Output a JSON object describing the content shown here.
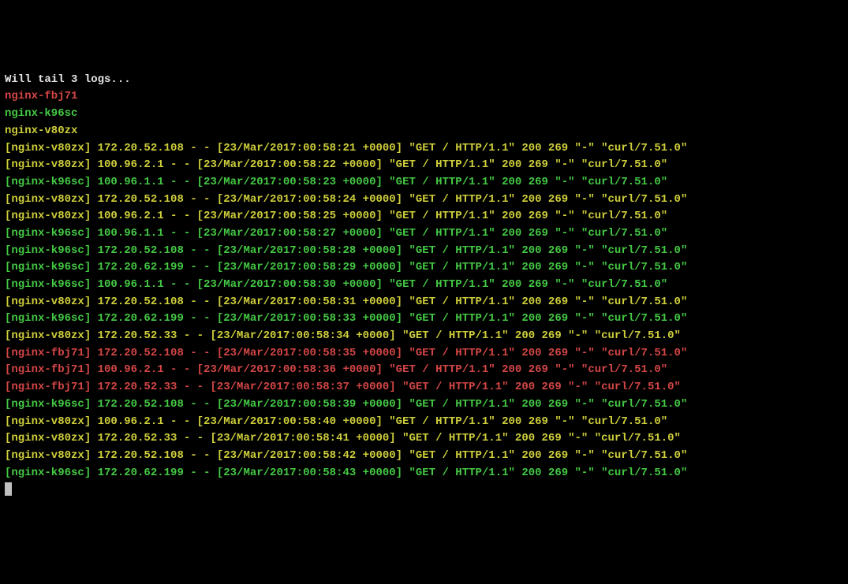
{
  "header": {
    "intro": "Will tail 3 logs...",
    "pods": [
      {
        "name": "nginx-fbj71",
        "color": "red"
      },
      {
        "name": "nginx-k96sc",
        "color": "green"
      },
      {
        "name": "nginx-v80zx",
        "color": "yellow"
      }
    ]
  },
  "logs": [
    {
      "pod": "nginx-v80zx",
      "color": "yellow",
      "msg": "172.20.52.108 - - [23/Mar/2017:00:58:21 +0000] \"GET / HTTP/1.1\" 200 269 \"-\" \"curl/7.51.0\""
    },
    {
      "pod": "nginx-v80zx",
      "color": "yellow",
      "msg": "100.96.2.1 - - [23/Mar/2017:00:58:22 +0000] \"GET / HTTP/1.1\" 200 269 \"-\" \"curl/7.51.0\""
    },
    {
      "pod": "nginx-k96sc",
      "color": "green",
      "msg": "100.96.1.1 - - [23/Mar/2017:00:58:23 +0000] \"GET / HTTP/1.1\" 200 269 \"-\" \"curl/7.51.0\""
    },
    {
      "pod": "nginx-v80zx",
      "color": "yellow",
      "msg": "172.20.52.108 - - [23/Mar/2017:00:58:24 +0000] \"GET / HTTP/1.1\" 200 269 \"-\" \"curl/7.51.0\""
    },
    {
      "pod": "nginx-v80zx",
      "color": "yellow",
      "msg": "100.96.2.1 - - [23/Mar/2017:00:58:25 +0000] \"GET / HTTP/1.1\" 200 269 \"-\" \"curl/7.51.0\""
    },
    {
      "pod": "nginx-k96sc",
      "color": "green",
      "msg": "100.96.1.1 - - [23/Mar/2017:00:58:27 +0000] \"GET / HTTP/1.1\" 200 269 \"-\" \"curl/7.51.0\""
    },
    {
      "pod": "nginx-k96sc",
      "color": "green",
      "msg": "172.20.52.108 - - [23/Mar/2017:00:58:28 +0000] \"GET / HTTP/1.1\" 200 269 \"-\" \"curl/7.51.0\""
    },
    {
      "pod": "nginx-k96sc",
      "color": "green",
      "msg": "172.20.62.199 - - [23/Mar/2017:00:58:29 +0000] \"GET / HTTP/1.1\" 200 269 \"-\" \"curl/7.51.0\""
    },
    {
      "pod": "nginx-k96sc",
      "color": "green",
      "msg": "100.96.1.1 - - [23/Mar/2017:00:58:30 +0000] \"GET / HTTP/1.1\" 200 269 \"-\" \"curl/7.51.0\""
    },
    {
      "pod": "nginx-v80zx",
      "color": "yellow",
      "msg": "172.20.52.108 - - [23/Mar/2017:00:58:31 +0000] \"GET / HTTP/1.1\" 200 269 \"-\" \"curl/7.51.0\""
    },
    {
      "pod": "nginx-k96sc",
      "color": "green",
      "msg": "172.20.62.199 - - [23/Mar/2017:00:58:33 +0000] \"GET / HTTP/1.1\" 200 269 \"-\" \"curl/7.51.0\""
    },
    {
      "pod": "nginx-v80zx",
      "color": "yellow",
      "msg": "172.20.52.33 - - [23/Mar/2017:00:58:34 +0000] \"GET / HTTP/1.1\" 200 269 \"-\" \"curl/7.51.0\""
    },
    {
      "pod": "nginx-fbj71",
      "color": "red",
      "msg": "172.20.52.108 - - [23/Mar/2017:00:58:35 +0000] \"GET / HTTP/1.1\" 200 269 \"-\" \"curl/7.51.0\""
    },
    {
      "pod": "nginx-fbj71",
      "color": "red",
      "msg": "100.96.2.1 - - [23/Mar/2017:00:58:36 +0000] \"GET / HTTP/1.1\" 200 269 \"-\" \"curl/7.51.0\""
    },
    {
      "pod": "nginx-fbj71",
      "color": "red",
      "msg": "172.20.52.33 - - [23/Mar/2017:00:58:37 +0000] \"GET / HTTP/1.1\" 200 269 \"-\" \"curl/7.51.0\""
    },
    {
      "pod": "nginx-k96sc",
      "color": "green",
      "msg": "172.20.52.108 - - [23/Mar/2017:00:58:39 +0000] \"GET / HTTP/1.1\" 200 269 \"-\" \"curl/7.51.0\""
    },
    {
      "pod": "nginx-v80zx",
      "color": "yellow",
      "msg": "100.96.2.1 - - [23/Mar/2017:00:58:40 +0000] \"GET / HTTP/1.1\" 200 269 \"-\" \"curl/7.51.0\""
    },
    {
      "pod": "nginx-v80zx",
      "color": "yellow",
      "msg": "172.20.52.33 - - [23/Mar/2017:00:58:41 +0000] \"GET / HTTP/1.1\" 200 269 \"-\" \"curl/7.51.0\""
    },
    {
      "pod": "nginx-v80zx",
      "color": "yellow",
      "msg": "172.20.52.108 - - [23/Mar/2017:00:58:42 +0000] \"GET / HTTP/1.1\" 200 269 \"-\" \"curl/7.51.0\""
    },
    {
      "pod": "nginx-k96sc",
      "color": "green",
      "msg": "172.20.62.199 - - [23/Mar/2017:00:58:43 +0000] \"GET / HTTP/1.1\" 200 269 \"-\" \"curl/7.51.0\""
    }
  ]
}
